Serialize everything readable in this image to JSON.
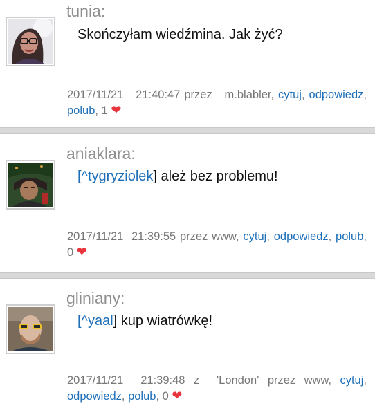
{
  "posts": [
    {
      "author": "tunia:",
      "text": "Skończyłam wiedźmina. Jak żyć?",
      "timestamp": "2017/11/21   21:40:47",
      "via": "przez   m.blabler,",
      "actions": {
        "quote": "cytuj",
        "reply": "odpowiedz",
        "like": "polub"
      },
      "likes": "1",
      "avatar_icon": "woman-with-glasses-avatar"
    },
    {
      "author": "aniaklara:",
      "mention_prefix": "[^",
      "mention": "tygryziolek",
      "mention_suffix": "]",
      "text": " ależ bez problemu!",
      "timestamp": "2017/11/21  21:39:55",
      "via": "przez www,",
      "actions": {
        "quote": "cytuj",
        "reply": "odpowiedz",
        "like": "polub"
      },
      "likes": "0",
      "avatar_icon": "woman-under-tree-avatar"
    },
    {
      "author": "gliniany:",
      "mention_prefix": "[^",
      "mention": "yaal",
      "mention_suffix": "]",
      "text": " kup wiatrówkę!",
      "timestamp": "2017/11/21  21:39:48",
      "location": "z  'London'",
      "via": "przez www,",
      "actions": {
        "quote": "cytuj",
        "reply": "odpowiedz",
        "like": "polub"
      },
      "likes": "0",
      "avatar_icon": "bearded-man-sunglasses-avatar"
    }
  ],
  "colors": {
    "link": "#1e6fb8",
    "heart": "#e8343c",
    "separator": "#d9d9d9"
  }
}
